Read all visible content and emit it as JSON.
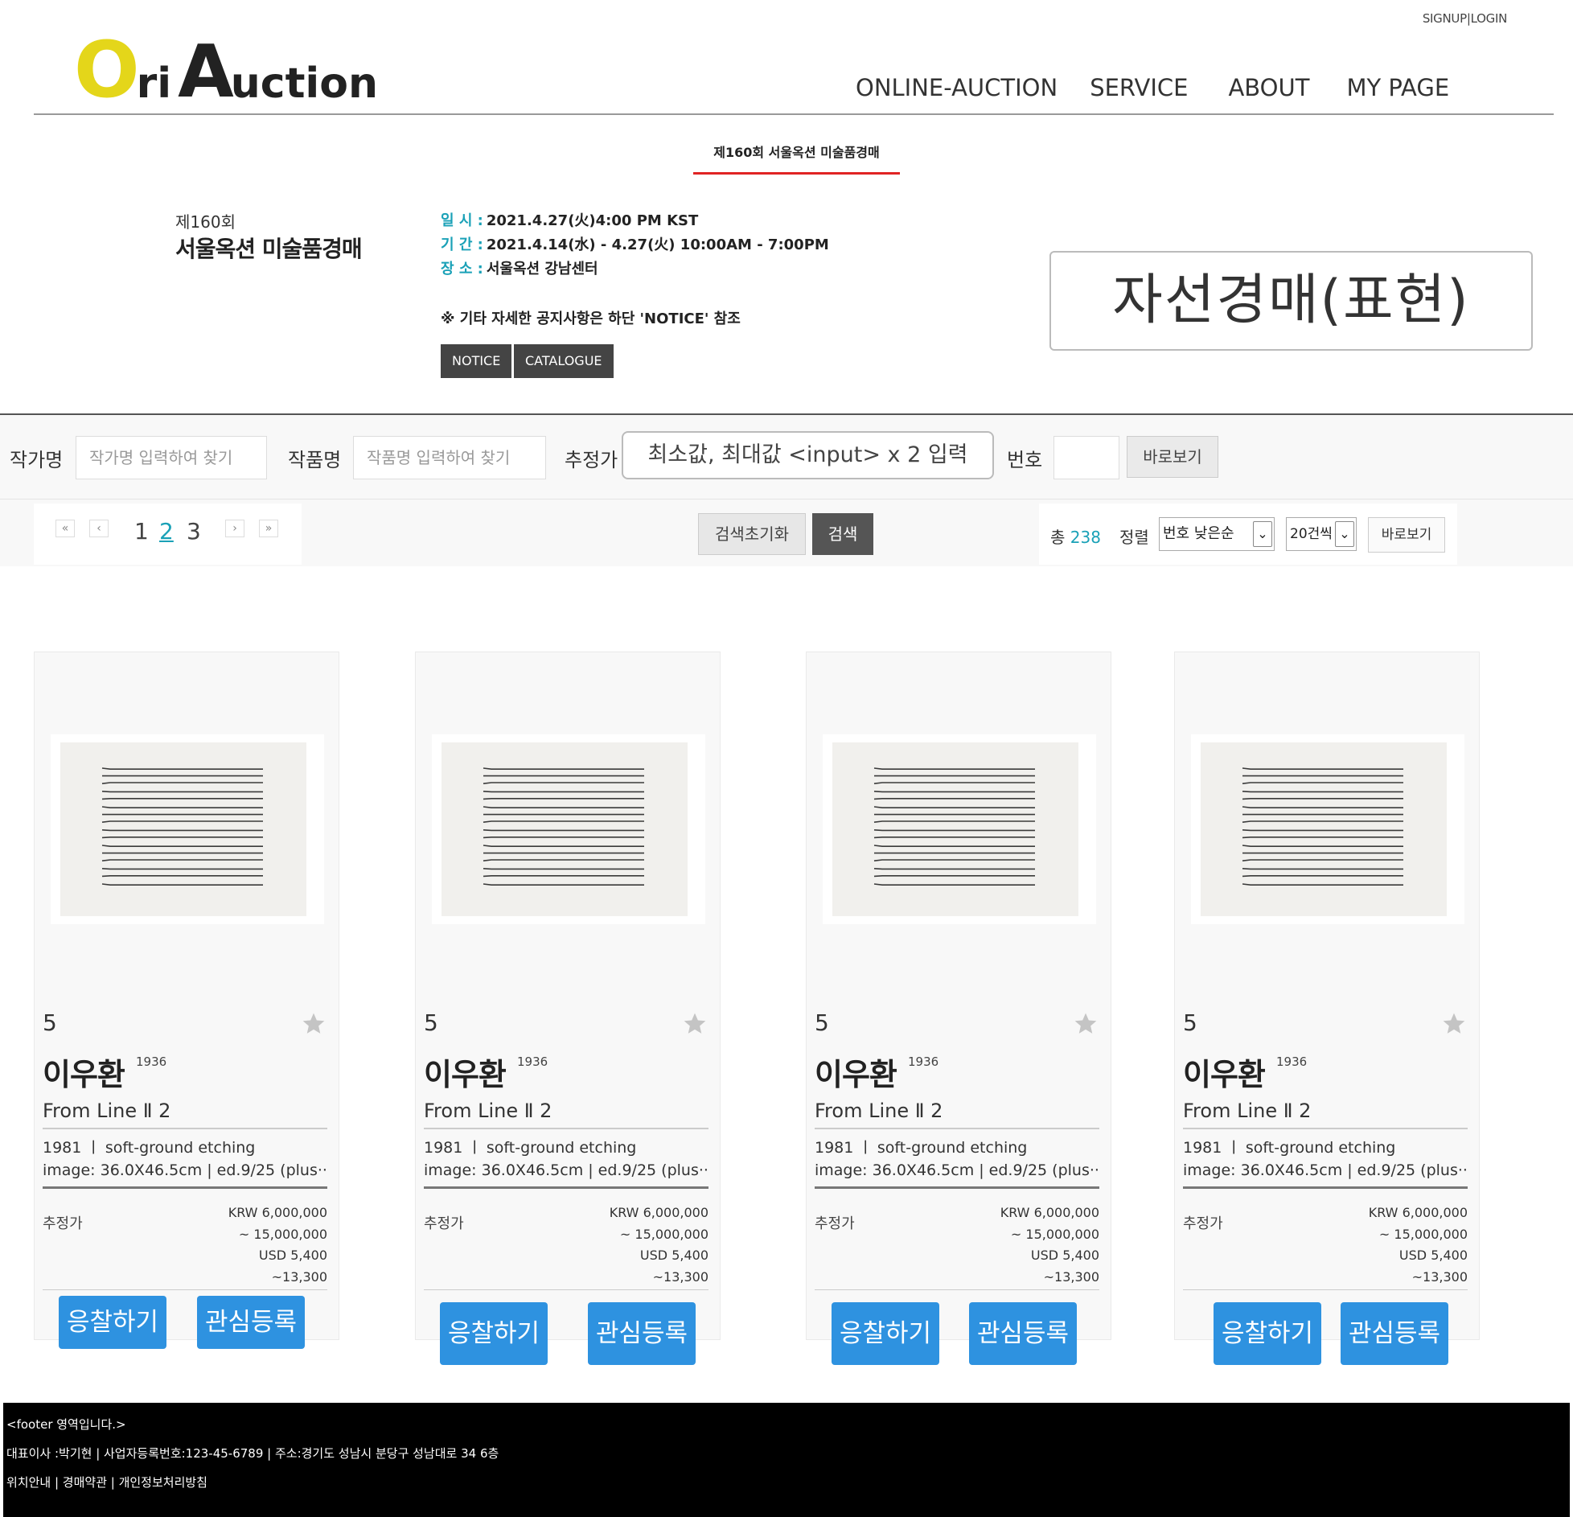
{
  "header": {
    "signup": "SIGNUP",
    "separator": "|",
    "login": "LOGIN",
    "logo": {
      "o": "O",
      "ri": "ri",
      "a": "A",
      "uction": "uction"
    },
    "nav": [
      "ONLINE-AUCTION",
      "SERVICE",
      "ABOUT",
      "MY PAGE"
    ]
  },
  "auction": {
    "tab_label": "제160회 서울옥션 미술품경매",
    "round": "제160회",
    "title": "서울옥션 미술품경매",
    "info": [
      {
        "label": "일 시 :",
        "value": "2021.4.27(火)4:00 PM KST"
      },
      {
        "label": "기 간 :",
        "value": "2021.4.14(水) - 4.27(火) 10:00AM - 7:00PM"
      },
      {
        "label": "장 소 :",
        "value": "서울옥션 강남센터"
      }
    ],
    "note": "※ 기타 자세한 공지사항은 하단 'NOTICE' 참조",
    "buttons": [
      "NOTICE",
      "CATALOGUE"
    ],
    "type_box": "자선경매(표현)"
  },
  "filters": {
    "artist_label": "작가명",
    "artist_placeholder": "작가명 입력하여 찾기",
    "work_label": "작품명",
    "work_placeholder": "작품명 입력하여 찾기",
    "estimate_label": "추정가",
    "estimate_box": "최소값, 최대값 <input> x 2 입력",
    "number_label": "번호",
    "goto_button": "바로보기"
  },
  "paging": {
    "first": "«",
    "prev": "‹",
    "pages": [
      "1",
      "2",
      "3"
    ],
    "active_page": "2",
    "next": "›",
    "last": "»"
  },
  "actions": {
    "reset": "검색초기화",
    "search": "검색"
  },
  "sort": {
    "total_label": "총",
    "total_count": "238",
    "sort_label": "정렬",
    "sort_value": "번호 낮은순",
    "per_page_value": "20건씩",
    "view_button": "바로보기",
    "arrow": "⌄"
  },
  "cards": [
    {
      "lot": "5",
      "artist": "이우환",
      "birth_year": "1936",
      "title": "From Line Ⅱ 2",
      "meta_line1": "1981  ㅣ  soft-ground etching",
      "meta_line2": "image: 36.0X46.5cm  | ed.9/25 (plus···",
      "estimate_label": "추정가",
      "estimate_lines": [
        "KRW 6,000,000",
        "~ 15,000,000",
        "USD 5,400",
        "~13,300"
      ],
      "bid_button": "응찰하기",
      "watch_button": "관심등록"
    },
    {
      "lot": "5",
      "artist": "이우환",
      "birth_year": "1936",
      "title": "From Line Ⅱ 2",
      "meta_line1": "1981  ㅣ  soft-ground etching",
      "meta_line2": "image: 36.0X46.5cm  | ed.9/25 (plus···",
      "estimate_label": "추정가",
      "estimate_lines": [
        "KRW 6,000,000",
        "~ 15,000,000",
        "USD 5,400",
        "~13,300"
      ],
      "bid_button": "응찰하기",
      "watch_button": "관심등록"
    },
    {
      "lot": "5",
      "artist": "이우환",
      "birth_year": "1936",
      "title": "From Line Ⅱ 2",
      "meta_line1": "1981  ㅣ  soft-ground etching",
      "meta_line2": "image: 36.0X46.5cm  | ed.9/25 (plus···",
      "estimate_label": "추정가",
      "estimate_lines": [
        "KRW 6,000,000",
        "~ 15,000,000",
        "USD 5,400",
        "~13,300"
      ],
      "bid_button": "응찰하기",
      "watch_button": "관심등록"
    },
    {
      "lot": "5",
      "artist": "이우환",
      "birth_year": "1936",
      "title": "From Line Ⅱ 2",
      "meta_line1": "1981  ㅣ  soft-ground etching",
      "meta_line2": "image: 36.0X46.5cm  | ed.9/25 (plus···",
      "estimate_label": "추정가",
      "estimate_lines": [
        "KRW 6,000,000",
        "~ 15,000,000",
        "USD 5,400",
        "~13,300"
      ],
      "bid_button": "응찰하기",
      "watch_button": "관심등록"
    }
  ],
  "footer": {
    "line1": "<footer 영역입니다.>",
    "line2": "대표이사 :박기현 | 사업자등록번호:123-45-6789 | 주소:경기도 성남시 분당구 성남대로 34 6층",
    "line3": "위치안내 | 경매약관 | 개인정보처리방침"
  },
  "colors": {
    "accent": "#1aa1b7",
    "tab_underline": "#e02424",
    "button_blue": "#2e92e0",
    "logo_yellow": "#e4d61a"
  },
  "icons": {
    "star": "star-icon",
    "artwork": "artwork-thumbnail"
  }
}
